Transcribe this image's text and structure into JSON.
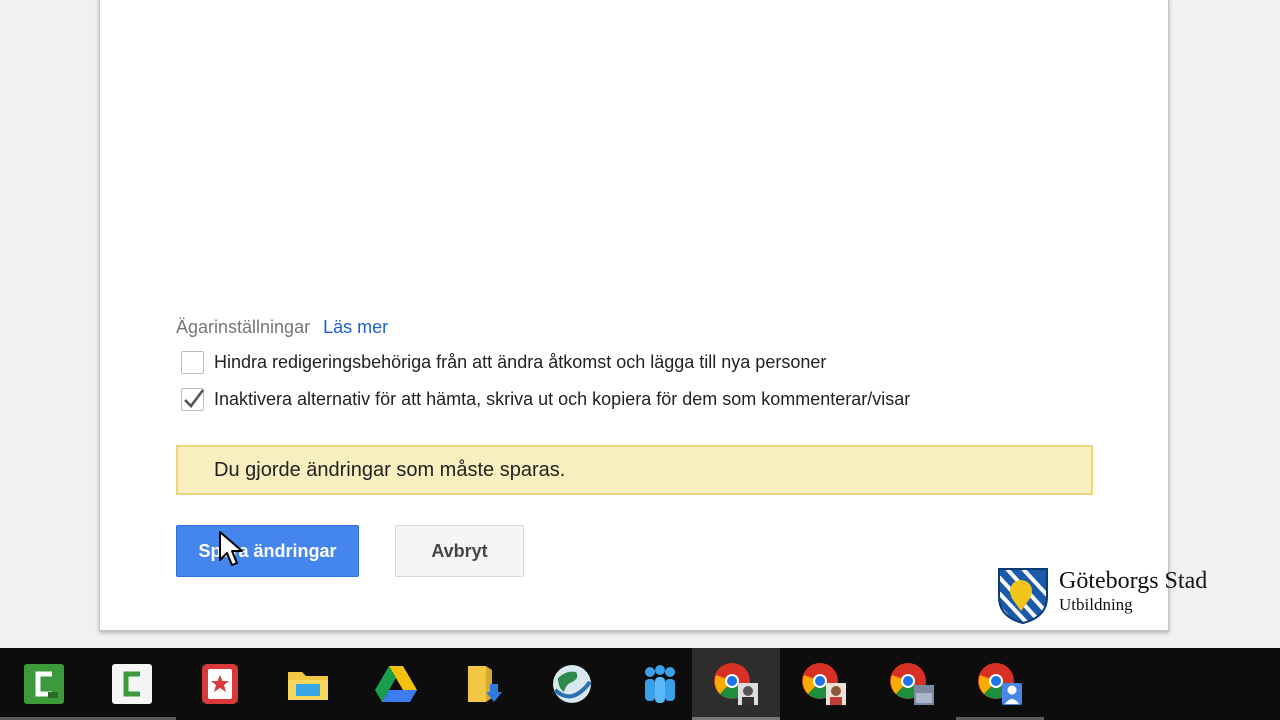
{
  "owner_settings": {
    "title": "Ägarinställningar",
    "learn_more": "Läs mer"
  },
  "options": [
    {
      "label": "Hindra redigeringsbehöriga från att ändra åtkomst och lägga till nya personer",
      "checked": false
    },
    {
      "label": "Inaktivera alternativ för att hämta, skriva ut och kopiera för dem som kommenterar/visar",
      "checked": true
    }
  ],
  "notice": "Du gjorde ändringar som måste sparas.",
  "buttons": {
    "save": "Spara ändringar",
    "cancel": "Avbryt"
  },
  "logo": {
    "name": "Göteborgs Stad",
    "subtitle": "Utbildning"
  },
  "taskbar": [
    {
      "icon": "camtasia-recorder-icon"
    },
    {
      "icon": "camtasia-studio-icon"
    },
    {
      "icon": "bookmark-app-icon"
    },
    {
      "icon": "file-explorer-icon"
    },
    {
      "icon": "google-drive-icon"
    },
    {
      "icon": "downloads-folder-icon"
    },
    {
      "icon": "network-globe-icon"
    },
    {
      "icon": "people-app-icon"
    },
    {
      "icon": "chrome-profile-1-icon",
      "active": true
    },
    {
      "icon": "chrome-profile-2-icon"
    },
    {
      "icon": "chrome-profile-3-icon"
    },
    {
      "icon": "chrome-profile-4-icon"
    }
  ],
  "colors": {
    "primary_button": "#4485ee",
    "link": "#1a5fd1",
    "notice_background": "#f9eec0",
    "notice_border": "#eed47f",
    "taskbar": "#0d0d0d"
  }
}
